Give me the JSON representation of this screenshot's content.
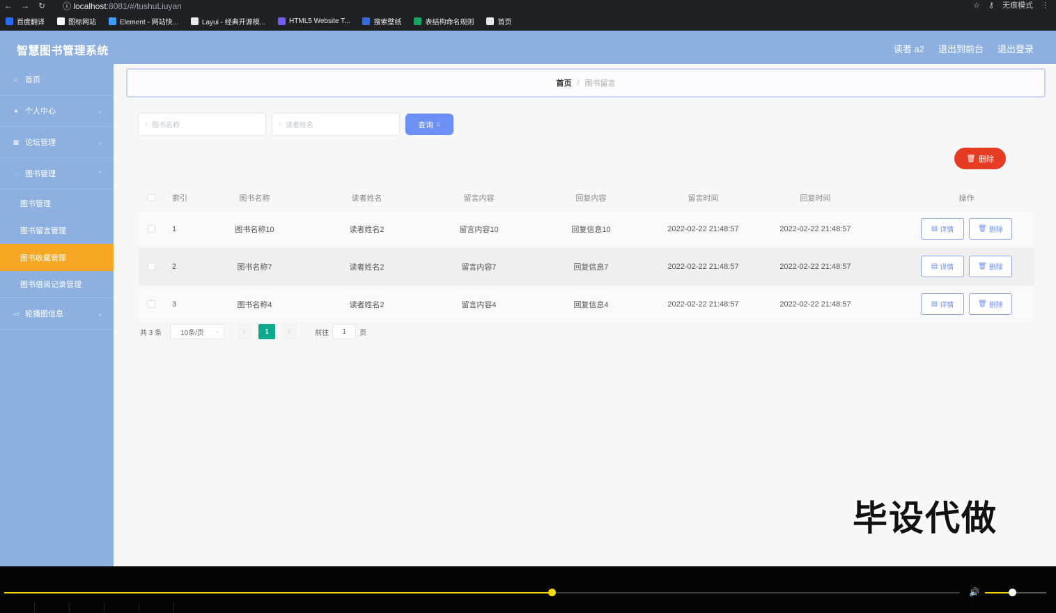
{
  "browser": {
    "url_host": "localhost",
    "url_rest": ":8081/#/tushuLiuyan",
    "incognito_label": "无痕模式",
    "bookmarks": [
      {
        "label": "百度翻译",
        "color": "#2a6df4"
      },
      {
        "label": "图标网站",
        "color": "#ffffff"
      },
      {
        "label": "Element - 网站快...",
        "color": "#409eff"
      },
      {
        "label": "Layui - 经典开源模...",
        "color": "#e8eaed"
      },
      {
        "label": "HTML5 Website T...",
        "color": "#6f5cf2"
      },
      {
        "label": "搜索壁纸",
        "color": "#3b6bd8"
      },
      {
        "label": "表结构命名规则",
        "color": "#1aa260"
      },
      {
        "label": "首页",
        "color": "#e8eaed"
      }
    ]
  },
  "header": {
    "title": "智慧图书管理系统",
    "user": "读者 a2",
    "to_front": "退出到前台",
    "logout": "退出登录"
  },
  "sidebar": {
    "items": [
      {
        "label": "首页",
        "icon": "home-icon",
        "glyph": "⌂"
      },
      {
        "label": "个人中心",
        "icon": "user-icon",
        "glyph": "●"
      },
      {
        "label": "论坛管理",
        "icon": "grid-icon",
        "glyph": "▦"
      },
      {
        "label": "图书管理",
        "icon": "book-icon",
        "glyph": "◌"
      }
    ],
    "subitems": [
      {
        "label": "图书管理"
      },
      {
        "label": "图书留言管理"
      },
      {
        "label": "图书收藏管理"
      },
      {
        "label": "图书借阅记录管理"
      }
    ],
    "last_item": {
      "label": "轮播图信息",
      "icon": "image-icon",
      "glyph": "▭"
    }
  },
  "breadcrumb": {
    "home": "首页",
    "separator": "/",
    "current": "图书留言"
  },
  "search": {
    "book_name_placeholder": "图书名称",
    "reader_name_placeholder": "读者姓名",
    "query_label": "查询"
  },
  "actions": {
    "delete_label": "删除"
  },
  "table": {
    "headers": [
      "索引",
      "图书名称",
      "读者姓名",
      "留言内容",
      "回复内容",
      "留言时间",
      "回复时间",
      "操作"
    ],
    "rows": [
      {
        "index": "1",
        "book": "图书名称10",
        "reader": "读者姓名2",
        "message": "留言内容10",
        "reply": "回复信息10",
        "msg_time": "2022-02-22 21:48:57",
        "reply_time": "2022-02-22 21:48:57"
      },
      {
        "index": "2",
        "book": "图书名称7",
        "reader": "读者姓名2",
        "message": "留言内容7",
        "reply": "回复信息7",
        "msg_time": "2022-02-22 21:48:57",
        "reply_time": "2022-02-22 21:48:57"
      },
      {
        "index": "3",
        "book": "图书名称4",
        "reader": "读者姓名2",
        "message": "留言内容4",
        "reply": "回复信息4",
        "msg_time": "2022-02-22 21:48:57",
        "reply_time": "2022-02-22 21:48:57"
      }
    ],
    "detail_label": "详情",
    "delete_label": "删除"
  },
  "pagination": {
    "total": "共 3 条",
    "page_size": "10条/页",
    "current_page": "1",
    "goto_prefix": "前往",
    "goto_value": "1",
    "goto_suffix": "页"
  },
  "watermark": "毕设代做",
  "player": {
    "progress": 0.573,
    "volume": 0.44
  }
}
